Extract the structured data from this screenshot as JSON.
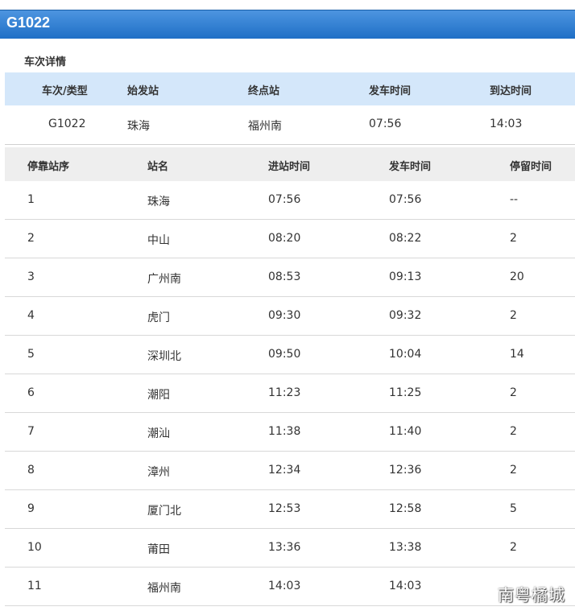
{
  "header": {
    "title": "G1022"
  },
  "section": {
    "title": "车次详情"
  },
  "summary": {
    "columns": [
      "车次/类型",
      "始发站",
      "终点站",
      "发车时间",
      "到达时间"
    ],
    "row": [
      "G1022",
      "珠海",
      "福州南",
      "07:56",
      "14:03"
    ]
  },
  "stops": {
    "columns": [
      "停靠站序",
      "站名",
      "进站时间",
      "发车时间",
      "停留时间"
    ],
    "rows": [
      [
        "1",
        "珠海",
        "07:56",
        "07:56",
        "--"
      ],
      [
        "2",
        "中山",
        "08:20",
        "08:22",
        "2"
      ],
      [
        "3",
        "广州南",
        "08:53",
        "09:13",
        "20"
      ],
      [
        "4",
        "虎门",
        "09:30",
        "09:32",
        "2"
      ],
      [
        "5",
        "深圳北",
        "09:50",
        "10:04",
        "14"
      ],
      [
        "6",
        "潮阳",
        "11:23",
        "11:25",
        "2"
      ],
      [
        "7",
        "潮汕",
        "11:38",
        "11:40",
        "2"
      ],
      [
        "8",
        "漳州",
        "12:34",
        "12:36",
        "2"
      ],
      [
        "9",
        "厦门北",
        "12:53",
        "12:58",
        "5"
      ],
      [
        "10",
        "莆田",
        "13:36",
        "13:38",
        "2"
      ],
      [
        "11",
        "福州南",
        "14:03",
        "14:03",
        ""
      ]
    ]
  },
  "watermark": {
    "text": "南粤橘城"
  }
}
